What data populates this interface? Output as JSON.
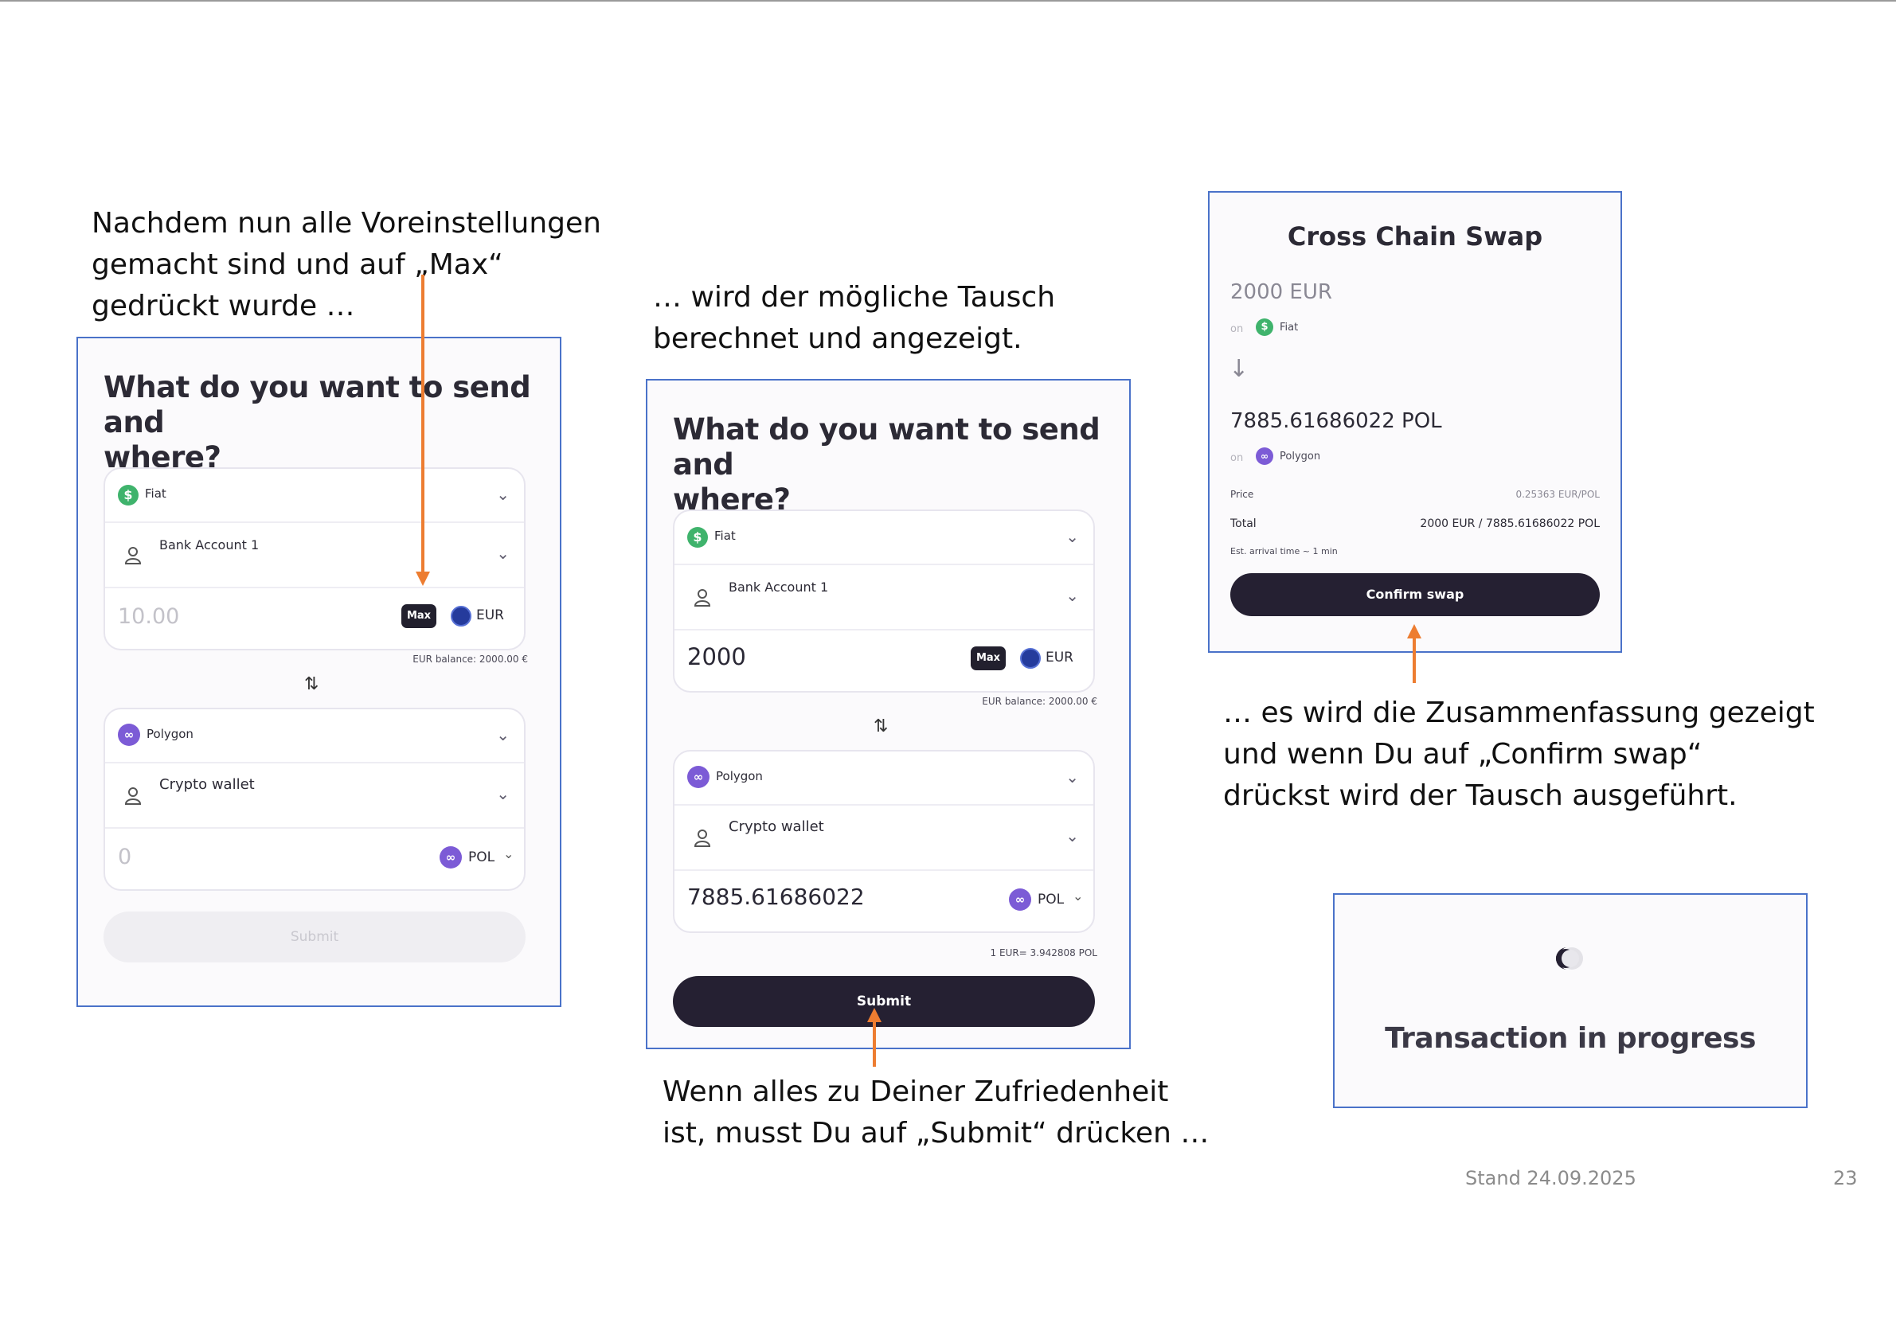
{
  "captions": {
    "step1": [
      "Nachdem nun alle Voreinstellungen",
      "gemacht sind und auf „Max“",
      "gedrückt wurde …"
    ],
    "step2": [
      "… wird der mögliche Tausch",
      "berechnet und angezeigt."
    ],
    "step3": [
      "Wenn alles zu Deiner Zufriedenheit",
      "ist, musst Du auf „Submit“ drücken …"
    ],
    "step4": [
      "… es wird die Zusammenfassung gezeigt",
      "und wenn Du auf „Confirm swap“",
      "drückst wird der Tausch ausgeführt."
    ]
  },
  "form1": {
    "title": [
      "What do you want to send and",
      "where?"
    ],
    "from_network": "Fiat",
    "from_account": "Bank Account 1",
    "amount_placeholder": "10.00",
    "max_label": "Max",
    "from_currency": "EUR",
    "balance": "EUR balance: 2000.00 €",
    "to_network": "Polygon",
    "to_account": "Crypto wallet",
    "to_amount": "0",
    "to_currency": "POL",
    "submit_label": "Submit"
  },
  "form2": {
    "title": [
      "What do you want to send and",
      "where?"
    ],
    "from_network": "Fiat",
    "from_account": "Bank Account 1",
    "amount": "2000",
    "max_label": "Max",
    "from_currency": "EUR",
    "balance": "EUR balance: 2000.00 €",
    "to_network": "Polygon",
    "to_account": "Crypto wallet",
    "to_amount": "7885.61686022",
    "to_currency": "POL",
    "rate": "1 EUR= 3.942808 POL",
    "submit_label": "Submit"
  },
  "swap": {
    "title": "Cross Chain Swap",
    "from_amount": "2000 EUR",
    "on_label": "on",
    "from_network": "Fiat",
    "arrow": "↓",
    "to_amount": "7885.61686022 POL",
    "to_network": "Polygon",
    "price_label": "Price",
    "price_value": "0.25363 EUR/POL",
    "total_label": "Total",
    "total_value": "2000 EUR / 7885.61686022 POL",
    "eta": "Est. arrival time ~ 1 min",
    "confirm_label": "Confirm swap"
  },
  "progress": {
    "text": "Transaction in progress"
  },
  "footer": {
    "stand": "Stand 24.09.2025",
    "page": "23"
  },
  "colors": {
    "accent_arrow": "#ed7d31",
    "card_border": "#4a72c9",
    "dark_button": "#252032",
    "fiat_green": "#3fb36c",
    "polygon_purple": "#7c5bd6"
  }
}
